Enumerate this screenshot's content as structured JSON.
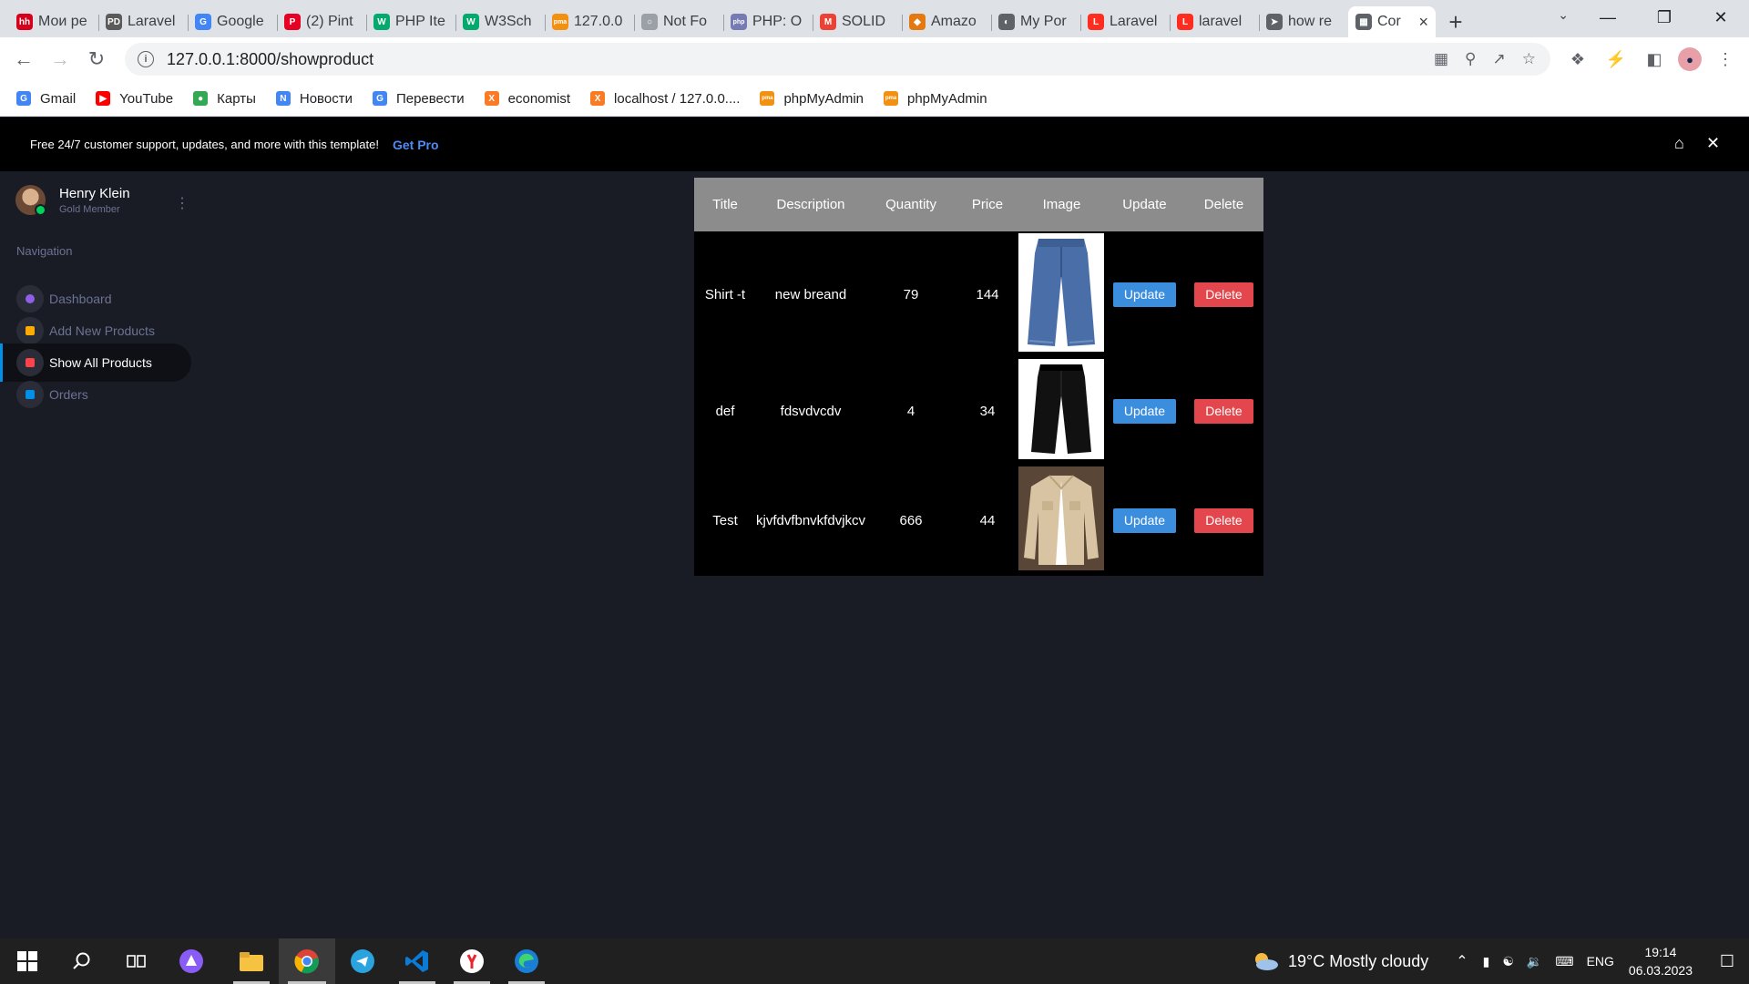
{
  "browser": {
    "tabs": [
      {
        "label": "Мои ре",
        "icon": "hh-icon",
        "color": "#d6001c",
        "glyph": "hh"
      },
      {
        "label": "Laravel",
        "icon": "pd-icon",
        "color": "#5b5b5b",
        "glyph": "PD"
      },
      {
        "label": "Google",
        "icon": "google-translate-icon",
        "color": "#4285f4",
        "glyph": "G"
      },
      {
        "label": "(2) Pint",
        "icon": "pinterest-icon",
        "color": "#e60023",
        "glyph": "P"
      },
      {
        "label": "PHP Ite",
        "icon": "w3-icon",
        "color": "#04aa6d",
        "glyph": "W"
      },
      {
        "label": "W3Sch",
        "icon": "w3-icon",
        "color": "#04aa6d",
        "glyph": "W"
      },
      {
        "label": "127.0.0",
        "icon": "phpmyadmin-icon",
        "color": "#f29111",
        "glyph": "pma"
      },
      {
        "label": "Not Fo",
        "icon": "globe-icon",
        "color": "#9aa0a6",
        "glyph": "○"
      },
      {
        "label": "PHP: O",
        "icon": "php-icon",
        "color": "#777bb3",
        "glyph": "php"
      },
      {
        "label": "SOLID",
        "icon": "gmail-icon",
        "color": "#ea4335",
        "glyph": "M"
      },
      {
        "label": "Amazo",
        "icon": "box-icon",
        "color": "#e47911",
        "glyph": "◆"
      },
      {
        "label": "My Por",
        "icon": "globe-icon",
        "color": "#5f6368",
        "glyph": "◐"
      },
      {
        "label": "Laravel",
        "icon": "laravel-icon",
        "color": "#ff2d20",
        "glyph": "L"
      },
      {
        "label": "laravel",
        "icon": "laravel-icon",
        "color": "#ff2d20",
        "glyph": "L"
      },
      {
        "label": "how re",
        "icon": "send-icon",
        "color": "#5f6368",
        "glyph": "➤"
      },
      {
        "label": "Cor",
        "icon": "page-icon",
        "color": "#5f6368",
        "glyph": "▦",
        "active": true
      }
    ],
    "url": "127.0.0.1:8000/showproduct",
    "bookmarks": [
      {
        "label": "Gmail",
        "icon": "google-icon",
        "color": "#4285f4",
        "glyph": "G"
      },
      {
        "label": "YouTube",
        "icon": "youtube-icon",
        "color": "#ff0000",
        "glyph": "▶"
      },
      {
        "label": "Карты",
        "icon": "maps-icon",
        "color": "#34a853",
        "glyph": "●"
      },
      {
        "label": "Новости",
        "icon": "news-icon",
        "color": "#4285f4",
        "glyph": "N"
      },
      {
        "label": "Перевести",
        "icon": "translate-icon",
        "color": "#4285f4",
        "glyph": "G"
      },
      {
        "label": "economist",
        "icon": "xampp-icon",
        "color": "#fb7a24",
        "glyph": "X"
      },
      {
        "label": "localhost / 127.0.0....",
        "icon": "xampp-icon",
        "color": "#fb7a24",
        "glyph": "X"
      },
      {
        "label": "phpMyAdmin",
        "icon": "phpmyadmin-icon",
        "color": "#f29111",
        "glyph": "pma"
      },
      {
        "label": "phpMyAdmin",
        "icon": "phpmyadmin-icon",
        "color": "#f29111",
        "glyph": "pma"
      }
    ]
  },
  "promo": {
    "text": "Free 24/7 customer support, updates, and more with this template!",
    "link": "Get Pro"
  },
  "sidebar": {
    "user_name": "Henry Klein",
    "user_role": "Gold Member",
    "nav_label": "Navigation",
    "items": [
      {
        "label": "Dashboard",
        "color": "#8f5fe8"
      },
      {
        "label": "Add New Products",
        "color": "#ffab00"
      },
      {
        "label": "Show All Products",
        "color": "#fc424a",
        "active": true
      },
      {
        "label": "Orders",
        "color": "#0090e7"
      }
    ]
  },
  "table": {
    "headers": [
      "Title",
      "Description",
      "Quantity",
      "Price",
      "Image",
      "Update",
      "Delete"
    ],
    "rows": [
      {
        "title": "Shirt -t",
        "description": "new breand",
        "quantity": "79",
        "price": "144",
        "image": "jeans",
        "update": "Update",
        "delete": "Delete"
      },
      {
        "title": "def",
        "description": "fdsvdvcdv",
        "quantity": "4",
        "price": "34",
        "image": "black-pants",
        "update": "Update",
        "delete": "Delete"
      },
      {
        "title": "Test",
        "description": "kjvfdvfbnvkfdvjkcv",
        "quantity": "666",
        "price": "44",
        "image": "beige-jacket",
        "update": "Update",
        "delete": "Delete"
      }
    ]
  },
  "taskbar": {
    "weather": "19°C  Mostly cloudy",
    "language": "ENG",
    "time": "19:14",
    "date": "06.03.2023"
  }
}
